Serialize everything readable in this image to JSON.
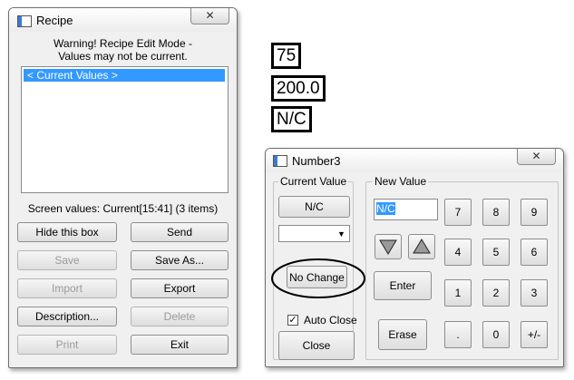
{
  "recipe_window": {
    "title": "Recipe",
    "close_symbol": "✕",
    "warning_line1": "Warning! Recipe Edit Mode -",
    "warning_line2": "Values may not be current.",
    "list_items": [
      "< Current Values >"
    ],
    "screen_values": "Screen values: Current[15:41] (3 items)",
    "buttons": {
      "hide": "Hide this box",
      "send": "Send",
      "save": "Save",
      "save_as": "Save As...",
      "import": "Import",
      "export": "Export",
      "description": "Description...",
      "delete": "Delete",
      "print": "Print",
      "exit": "Exit"
    }
  },
  "display_values": {
    "value1": "75",
    "value2": "200.0",
    "value3": "N/C"
  },
  "number_window": {
    "title": "Number3",
    "close_symbol": "✕",
    "current_value_label": "Current Value",
    "current_value": "N/C",
    "dropdown_value": "",
    "no_change": "No Change",
    "auto_close_label": "Auto Close",
    "auto_close_checked": true,
    "close": "Close",
    "new_value_label": "New Value",
    "new_value": "N/C",
    "enter": "Enter",
    "erase": "Erase",
    "keys": {
      "k7": "7",
      "k8": "8",
      "k9": "9",
      "k4": "4",
      "k5": "5",
      "k6": "6",
      "k1": "1",
      "k2": "2",
      "k3": "3",
      "dot": ".",
      "k0": "0",
      "sign": "+/-"
    }
  },
  "colors": {
    "selection": "#3399ff",
    "window_bg": "#f0f0f0",
    "annotation_ellipse": "#000000"
  }
}
